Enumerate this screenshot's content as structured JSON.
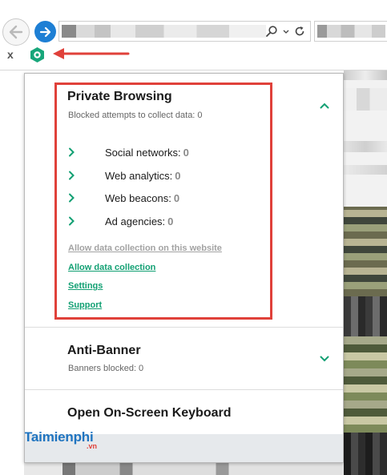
{
  "browser": {
    "address_search_icon": "search-icon",
    "address_refresh_icon": "refresh-icon",
    "close_label": "x"
  },
  "panel": {
    "private_browsing": {
      "title": "Private Browsing",
      "subtitle": "Blocked attempts to collect data: 0",
      "stats": [
        {
          "label": "Social networks:",
          "value": "0"
        },
        {
          "label": "Web analytics:",
          "value": "0"
        },
        {
          "label": "Web beacons:",
          "value": "0"
        },
        {
          "label": "Ad agencies:",
          "value": "0"
        }
      ],
      "links": {
        "allow_site": "Allow data collection on this website",
        "allow_all": "Allow data collection",
        "settings": "Settings",
        "support": "Support"
      }
    },
    "anti_banner": {
      "title": "Anti-Banner",
      "subtitle": "Banners blocked: 0"
    },
    "keyboard": {
      "title": "Open On-Screen Keyboard"
    }
  },
  "watermark": {
    "main": "Taimienphi",
    "suffix": ".vn"
  },
  "colors": {
    "accent_green": "#12a073",
    "highlight_red": "#e0413a",
    "browser_blue": "#1e7fd4",
    "watermark_blue": "#1f74c0"
  }
}
